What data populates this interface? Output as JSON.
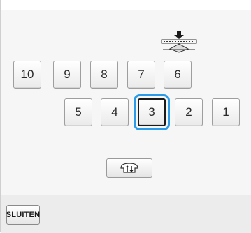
{
  "keypad": {
    "row1": [
      "10",
      "9",
      "8",
      "7",
      "6"
    ],
    "row2": [
      "5",
      "4",
      "3",
      "2",
      "1"
    ],
    "selected": "3"
  },
  "icons": {
    "presser_foot": "presser-foot-height-icon",
    "mode": "foot-up-down-icon"
  },
  "footer": {
    "close_label": "SLUITEN"
  },
  "colors": {
    "selection_outline": "#2a9be8",
    "background": "#f6f6f6"
  }
}
